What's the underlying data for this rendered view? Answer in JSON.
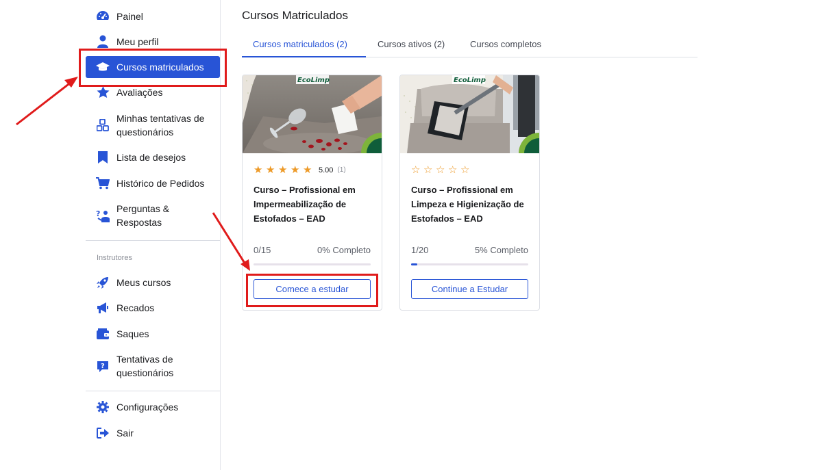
{
  "sidebar": {
    "items": [
      {
        "label": "Painel",
        "icon": "dashboard-gauge-icon"
      },
      {
        "label": "Meu perfil",
        "icon": "user-icon"
      },
      {
        "label": "Cursos matriculados",
        "icon": "graduation-cap-icon",
        "active": true
      },
      {
        "label": "Avaliações",
        "icon": "star-icon"
      },
      {
        "label": "Minhas tentativas de questionários",
        "icon": "quiz-blocks-icon"
      },
      {
        "label": "Lista de desejos",
        "icon": "bookmark-icon"
      },
      {
        "label": "Histórico de Pedidos",
        "icon": "cart-icon"
      },
      {
        "label": "Perguntas & Respostas",
        "icon": "question-answer-icon"
      }
    ],
    "instructors_label": "Instrutores",
    "instructor_items": [
      {
        "label": "Meus cursos",
        "icon": "rocket-icon"
      },
      {
        "label": "Recados",
        "icon": "megaphone-icon"
      },
      {
        "label": "Saques",
        "icon": "wallet-icon"
      },
      {
        "label": "Tentativas de questionários",
        "icon": "question-bubble-icon"
      }
    ],
    "footer_items": [
      {
        "label": "Configurações",
        "icon": "gear-icon"
      },
      {
        "label": "Sair",
        "icon": "logout-icon"
      }
    ]
  },
  "main": {
    "title": "Cursos Matriculados",
    "tabs": [
      {
        "label": "Cursos matriculados (2)",
        "active": true
      },
      {
        "label": "Cursos ativos (2)"
      },
      {
        "label": "Cursos completos"
      }
    ],
    "courses": [
      {
        "title": "Curso – Profissional em Impermeabilização de Estofados – EAD",
        "rating": "5.00",
        "rating_count": "(1)",
        "stars_filled": 5,
        "progress_text": "0/15",
        "progress_pct_text": "0% Completo",
        "progress_fraction": 0,
        "button": "Comece a estudar",
        "thumb_logo": "EcoLimp"
      },
      {
        "title": "Curso – Profissional em Limpeza e Higienização de Estofados – EAD",
        "rating": "",
        "rating_count": "",
        "stars_filled": 0,
        "progress_text": "1/20",
        "progress_pct_text": "5% Completo",
        "progress_fraction": 0.05,
        "button": "Continue a Estudar",
        "thumb_logo": "EcoLimp"
      }
    ]
  },
  "colors": {
    "accent": "#2854d6",
    "star": "#ed9a28",
    "annotation": "#e01b1b"
  }
}
